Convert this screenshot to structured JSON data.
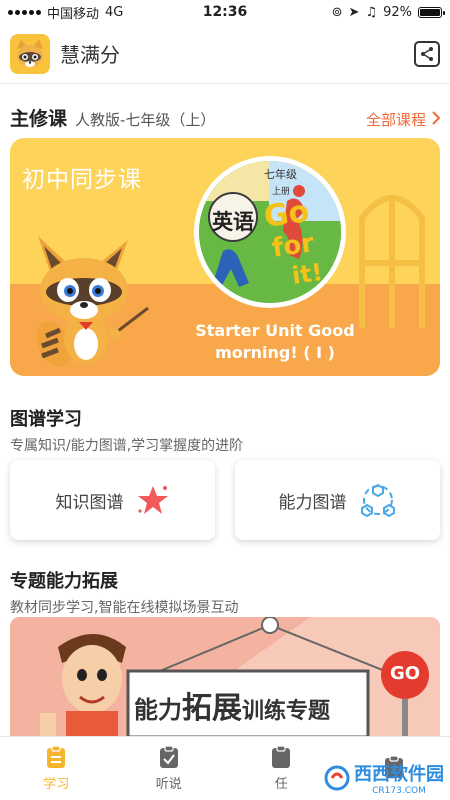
{
  "status_bar": {
    "carrier": "中国移动",
    "network": "4G",
    "time": "12:36",
    "battery": "92%",
    "battery_level": 0.92
  },
  "header": {
    "app_name": "慧满分",
    "logo_icon": "raccoon-logo-icon",
    "share_icon": "share-icon"
  },
  "main_course": {
    "title": "主修课",
    "edition": "人教版-七年级（上）",
    "all_courses_label": "全部课程"
  },
  "banner": {
    "label": "初中同步课",
    "cover_subject": "英语",
    "cover_grade": "七年级",
    "cover_volume": "上册",
    "cover_title_1": "Go",
    "cover_title_2": "for",
    "cover_title_3": "it!",
    "lesson_title_line1": "Starter Unit Good",
    "lesson_title_line2": "morning! ( I )"
  },
  "map_section": {
    "title": "图谱学习",
    "subtitle": "专属知识/能力图谱,学习掌握度的进阶",
    "cards": [
      {
        "label": "知识图谱",
        "icon": "star-icon"
      },
      {
        "label": "能力图谱",
        "icon": "hexagon-network-icon"
      }
    ]
  },
  "special_section": {
    "title": "专题能力拓展",
    "subtitle": "教材同步学习,智能在线模拟场景互动",
    "banner_text_1": "能力",
    "banner_text_2": "拓展",
    "banner_text_3": "训练专题",
    "banner_sign": "GO"
  },
  "tab_bar": {
    "tabs": [
      {
        "label": "学习",
        "icon": "study-icon",
        "active": true
      },
      {
        "label": "听说",
        "icon": "clipboard-check-icon",
        "active": false
      },
      {
        "label": "任",
        "icon": "task-icon",
        "active": false
      },
      {
        "label": "",
        "icon": "profile-icon",
        "active": false
      }
    ]
  },
  "watermark": {
    "brand": "西西软件园",
    "domain": "CR173.COM"
  },
  "colors": {
    "accent_orange": "#f06a3a",
    "banner_yellow": "#fdd35a",
    "tab_active": "#f4b62f"
  }
}
